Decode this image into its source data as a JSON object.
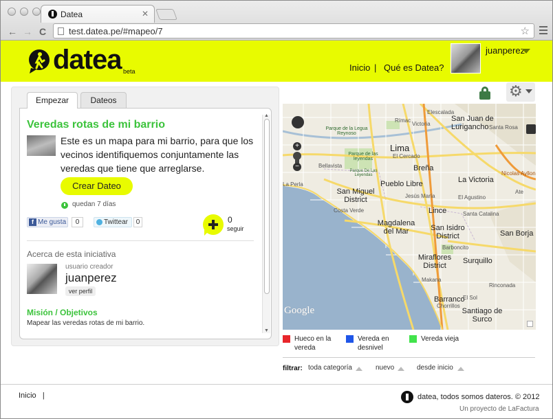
{
  "browser": {
    "tab_title": "Datea",
    "tab_close": "✕",
    "url": "test.datea.pe/#mapeo/7",
    "back": "←",
    "forward": "→",
    "reload": "C",
    "star": "☆"
  },
  "header": {
    "logo_text": "datea",
    "beta": "beta",
    "nav": [
      "Inicio",
      "|",
      "Qué es Datea?"
    ],
    "username": "juanperez"
  },
  "tabs": [
    "Empezar",
    "Dateos"
  ],
  "campaign": {
    "title": "Veredas rotas de mi barrio",
    "description": "Este es un mapa para mi barrio, para que los vecinos identifiquemos conjuntamente las veredas que tiene que arreglarse.",
    "create_button": "Crear Dateo",
    "remaining": "quedan 7 días",
    "fb_label": "Me gusta",
    "fb_icon": "f",
    "fb_count": "0",
    "tw_label": "Twittear",
    "tw_count": "0",
    "follow_count": "0",
    "follow_label": "seguir",
    "about_heading": "Acerca de esta iniciativa",
    "creator_label": "usuario creador",
    "creator_name": "juanperez",
    "profile_button": "ver perfil",
    "mission_heading": "Misión / Objetivos",
    "mission_text": "Mapear las veredas rotas de mi barrio."
  },
  "map": {
    "labels": [
      "Lima",
      "San Juan de Lurigancho",
      "La Perla",
      "San Miguel District",
      "Pueblo Libre",
      "Breña",
      "La Victoria",
      "Jesús María",
      "Lince",
      "Costa Verde",
      "Magdalena del Mar",
      "San Isidro District",
      "San Borja",
      "Miraflores District",
      "Surquillo",
      "Barranco",
      "Santiago de Surco",
      "Bellavista",
      "Ate",
      "El Agustino",
      "Santa Catalina",
      "Barboncito",
      "Makana",
      "El Sol",
      "Chorrillos",
      "Nicolas Ayllon",
      "Parque de la Legua Reynoso",
      "Parque de las leyendas",
      "Parque De Las Leyendas",
      "Elescalada",
      "Victoria",
      "Rímac",
      "El Cercado",
      "Rinconada",
      "Santa Rosa"
    ],
    "zoom_in": "+",
    "zoom_out": "−",
    "google": "Google"
  },
  "legend": [
    {
      "label": "Hueco en la vereda",
      "color": "#e8262b"
    },
    {
      "label": "Vereda en desnivel",
      "color": "#1f56e8"
    },
    {
      "label": "Vereda vieja",
      "color": "#42e34c"
    }
  ],
  "filters": {
    "heading": "filtrar:",
    "options": [
      "toda categoría",
      "nuevo",
      "desde inicio"
    ]
  },
  "footer": {
    "home": "Inicio",
    "separator": "|",
    "tagline": "datea, todos somos dateros. © 2012",
    "credit": "Un proyecto de LaFactura"
  },
  "colors": {
    "brand_yellow": "#e8fb00",
    "accent_green": "#3cc33c"
  }
}
